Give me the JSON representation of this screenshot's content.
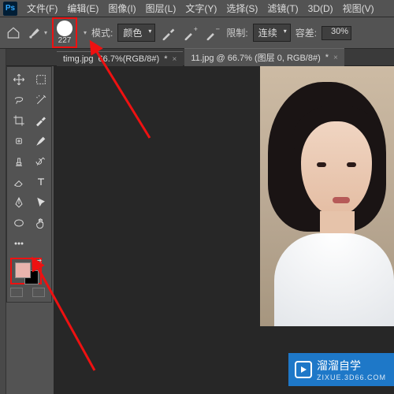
{
  "menu": {
    "items": [
      "文件(F)",
      "编辑(E)",
      "图像(I)",
      "图层(L)",
      "文字(Y)",
      "选择(S)",
      "滤镜(T)",
      "3D(D)",
      "视图(V)"
    ]
  },
  "options": {
    "brush_size": "227",
    "mode_label": "模式:",
    "mode_value": "颜色",
    "limit_label": "限制:",
    "limit_value": "连续",
    "tolerance_label": "容差:",
    "tolerance_value": "30%"
  },
  "tabs": [
    {
      "label": "timg.jpg",
      "detail": "66.7%(RGB/8#)",
      "dirty": "*"
    },
    {
      "label": "11.jpg @ 66.7% (图层 0, RGB/8#)",
      "detail": "",
      "dirty": "*"
    }
  ],
  "swatches": {
    "fg": "#eab3ad",
    "bg": "#000000"
  },
  "watermark": {
    "brand": "溜溜自学",
    "url": "ZIXUE.3D66.COM"
  },
  "icons": {
    "home": "home",
    "toolopt": "color-replace",
    "flow1": "sample-eyedrop",
    "flow2": "sample-plus",
    "flow3": "sample-minus"
  }
}
